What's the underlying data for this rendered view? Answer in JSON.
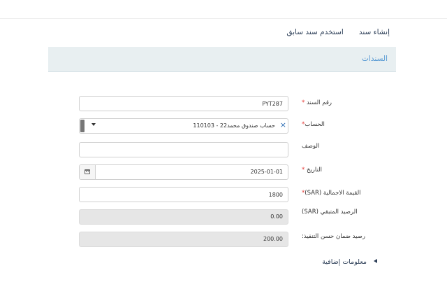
{
  "tabs": {
    "create": "إنشاء سند",
    "use_previous": "استخدم سند سابق"
  },
  "panel": {
    "title": "السندات"
  },
  "form": {
    "voucher_no": {
      "label": "رقم السند",
      "value": "PYT287"
    },
    "account": {
      "label": "الحساب",
      "value": "110103 - حساب صندوق محمد22"
    },
    "description": {
      "label": "الوصف",
      "value": ""
    },
    "date": {
      "label": "التاريخ",
      "value": "2025-01-01"
    },
    "total": {
      "label": "القيمة الاجمالية (SAR)",
      "value": "1800"
    },
    "remaining": {
      "label": "الرصيد المتبقي (SAR)",
      "value": "0.00"
    },
    "guarantee": {
      "label": "رصيد ضمان حسن التنفيذ:",
      "value": "200.00"
    }
  },
  "required_mark": "*",
  "clear_glyph": "×",
  "extra_info": "معلومات إضافية",
  "colors": {
    "accent": "#5a9bd4",
    "required": "#e53935",
    "panel_bg": "#e8eff1",
    "readonly_bg": "#e6e6e6"
  }
}
